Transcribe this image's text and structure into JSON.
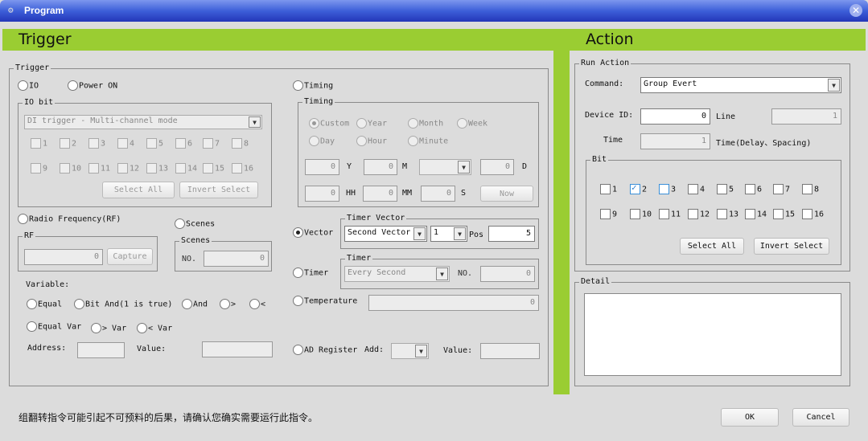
{
  "window": {
    "title": "Program",
    "close_icon": "close-icon"
  },
  "colors": {
    "accent": "#9acd32",
    "titlebar": "#3d5fd9"
  },
  "trigger": {
    "header": "Trigger",
    "group": "Trigger",
    "io": "IO",
    "power_on": "Power ON",
    "io_bit": {
      "legend": "IO bit",
      "mode": "DI trigger - Multi-channel mode",
      "bits": [
        "1",
        "2",
        "3",
        "4",
        "5",
        "6",
        "7",
        "8",
        "9",
        "10",
        "11",
        "12",
        "13",
        "14",
        "15",
        "16"
      ],
      "select_all": "Select All",
      "invert_select": "Invert Select"
    },
    "rf": {
      "radio": "Radio Frequency(RF)",
      "legend": "RF",
      "value": "0",
      "capture": "Capture"
    },
    "scenes": {
      "radio": "Scenes",
      "legend": "Scenes",
      "no_label": "NO.",
      "value": "0"
    },
    "variable": {
      "label": "Variable:",
      "ops": [
        "Equal",
        "Bit And(1 is true)",
        "And",
        ">",
        "<"
      ],
      "ops2": [
        "Equal Var",
        "> Var",
        "< Var"
      ],
      "address_label": "Address:",
      "address": "",
      "value_label": "Value:",
      "value": ""
    },
    "timing": {
      "radio": "Timing",
      "legend": "Timing",
      "modes": [
        "Custom",
        "Year",
        "Month",
        "Week",
        "Day",
        "Hour",
        "Minute"
      ],
      "selected": "Custom",
      "y": "0",
      "y_label": "Y",
      "m": "0",
      "m_label": "M",
      "weekday": "",
      "d": "0",
      "d_label": "D",
      "hh": "0",
      "hh_label": "HH",
      "mm": "0",
      "mm_label": "MM",
      "s": "0",
      "s_label": "S",
      "now": "Now"
    },
    "vector": {
      "radio": "Vector",
      "selected": true,
      "legend": "Timer Vector",
      "type": "Second Vector",
      "index": "1",
      "pos_label": "Pos",
      "pos": "5"
    },
    "timer": {
      "radio": "Timer",
      "legend": "Timer",
      "mode": "Every Second",
      "no_label": "NO.",
      "no": "0"
    },
    "temperature": {
      "radio": "Temperature",
      "value": "0"
    },
    "ad": {
      "radio": "AD Register",
      "add_label": "Add:",
      "add": "",
      "value_label": "Value:",
      "value": ""
    }
  },
  "action": {
    "header": "Action",
    "group": "Run Action",
    "command_label": "Command:",
    "command": "Group Evert",
    "device_id_label": "Device ID:",
    "device_id": "0",
    "line_label": "Line",
    "line": "1",
    "time_label": "Time",
    "time": "1",
    "time_hint": "Time(Delay、Spacing)",
    "bit": {
      "legend": "Bit",
      "bits": [
        "1",
        "2",
        "3",
        "4",
        "5",
        "6",
        "7",
        "8",
        "9",
        "10",
        "11",
        "12",
        "13",
        "14",
        "15",
        "16"
      ],
      "checked": [
        "2"
      ],
      "focused": "3",
      "select_all": "Select All",
      "invert_select": "Invert Select"
    },
    "detail": {
      "legend": "Detail",
      "text": ""
    }
  },
  "footer": {
    "warning": "组翻转指令可能引起不可预料的后果，请确认您确实需要运行此指令。",
    "ok": "OK",
    "cancel": "Cancel"
  }
}
